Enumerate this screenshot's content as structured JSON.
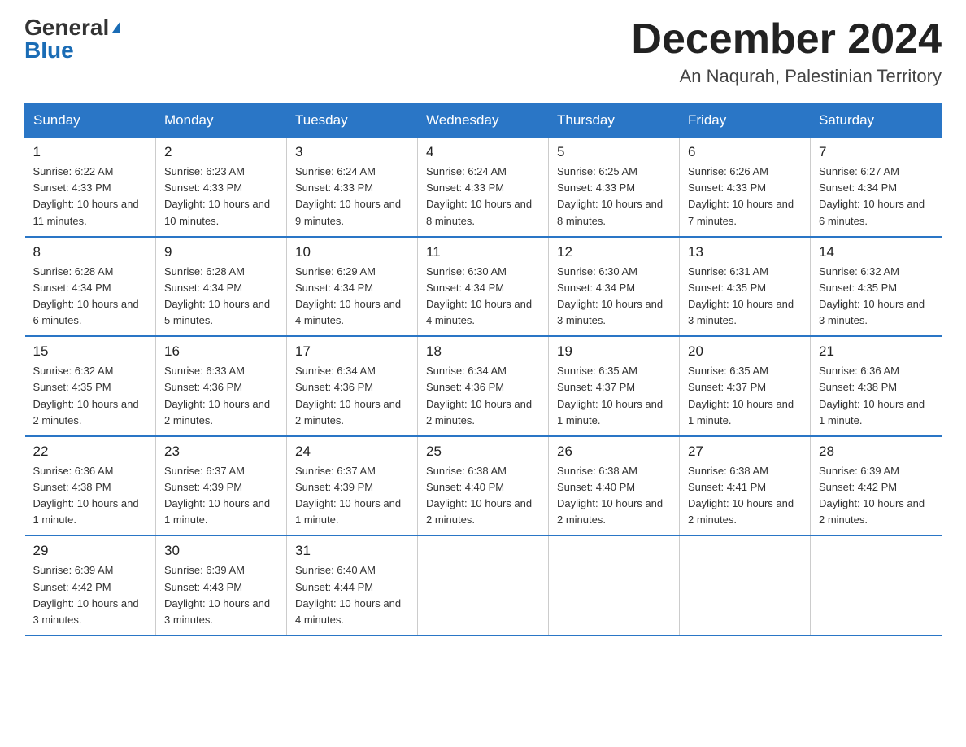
{
  "header": {
    "logo_general": "General",
    "logo_blue": "Blue",
    "month_title": "December 2024",
    "location": "An Naqurah, Palestinian Territory"
  },
  "columns": [
    "Sunday",
    "Monday",
    "Tuesday",
    "Wednesday",
    "Thursday",
    "Friday",
    "Saturday"
  ],
  "weeks": [
    [
      {
        "day": "1",
        "sunrise": "Sunrise: 6:22 AM",
        "sunset": "Sunset: 4:33 PM",
        "daylight": "Daylight: 10 hours and 11 minutes."
      },
      {
        "day": "2",
        "sunrise": "Sunrise: 6:23 AM",
        "sunset": "Sunset: 4:33 PM",
        "daylight": "Daylight: 10 hours and 10 minutes."
      },
      {
        "day": "3",
        "sunrise": "Sunrise: 6:24 AM",
        "sunset": "Sunset: 4:33 PM",
        "daylight": "Daylight: 10 hours and 9 minutes."
      },
      {
        "day": "4",
        "sunrise": "Sunrise: 6:24 AM",
        "sunset": "Sunset: 4:33 PM",
        "daylight": "Daylight: 10 hours and 8 minutes."
      },
      {
        "day": "5",
        "sunrise": "Sunrise: 6:25 AM",
        "sunset": "Sunset: 4:33 PM",
        "daylight": "Daylight: 10 hours and 8 minutes."
      },
      {
        "day": "6",
        "sunrise": "Sunrise: 6:26 AM",
        "sunset": "Sunset: 4:33 PM",
        "daylight": "Daylight: 10 hours and 7 minutes."
      },
      {
        "day": "7",
        "sunrise": "Sunrise: 6:27 AM",
        "sunset": "Sunset: 4:34 PM",
        "daylight": "Daylight: 10 hours and 6 minutes."
      }
    ],
    [
      {
        "day": "8",
        "sunrise": "Sunrise: 6:28 AM",
        "sunset": "Sunset: 4:34 PM",
        "daylight": "Daylight: 10 hours and 6 minutes."
      },
      {
        "day": "9",
        "sunrise": "Sunrise: 6:28 AM",
        "sunset": "Sunset: 4:34 PM",
        "daylight": "Daylight: 10 hours and 5 minutes."
      },
      {
        "day": "10",
        "sunrise": "Sunrise: 6:29 AM",
        "sunset": "Sunset: 4:34 PM",
        "daylight": "Daylight: 10 hours and 4 minutes."
      },
      {
        "day": "11",
        "sunrise": "Sunrise: 6:30 AM",
        "sunset": "Sunset: 4:34 PM",
        "daylight": "Daylight: 10 hours and 4 minutes."
      },
      {
        "day": "12",
        "sunrise": "Sunrise: 6:30 AM",
        "sunset": "Sunset: 4:34 PM",
        "daylight": "Daylight: 10 hours and 3 minutes."
      },
      {
        "day": "13",
        "sunrise": "Sunrise: 6:31 AM",
        "sunset": "Sunset: 4:35 PM",
        "daylight": "Daylight: 10 hours and 3 minutes."
      },
      {
        "day": "14",
        "sunrise": "Sunrise: 6:32 AM",
        "sunset": "Sunset: 4:35 PM",
        "daylight": "Daylight: 10 hours and 3 minutes."
      }
    ],
    [
      {
        "day": "15",
        "sunrise": "Sunrise: 6:32 AM",
        "sunset": "Sunset: 4:35 PM",
        "daylight": "Daylight: 10 hours and 2 minutes."
      },
      {
        "day": "16",
        "sunrise": "Sunrise: 6:33 AM",
        "sunset": "Sunset: 4:36 PM",
        "daylight": "Daylight: 10 hours and 2 minutes."
      },
      {
        "day": "17",
        "sunrise": "Sunrise: 6:34 AM",
        "sunset": "Sunset: 4:36 PM",
        "daylight": "Daylight: 10 hours and 2 minutes."
      },
      {
        "day": "18",
        "sunrise": "Sunrise: 6:34 AM",
        "sunset": "Sunset: 4:36 PM",
        "daylight": "Daylight: 10 hours and 2 minutes."
      },
      {
        "day": "19",
        "sunrise": "Sunrise: 6:35 AM",
        "sunset": "Sunset: 4:37 PM",
        "daylight": "Daylight: 10 hours and 1 minute."
      },
      {
        "day": "20",
        "sunrise": "Sunrise: 6:35 AM",
        "sunset": "Sunset: 4:37 PM",
        "daylight": "Daylight: 10 hours and 1 minute."
      },
      {
        "day": "21",
        "sunrise": "Sunrise: 6:36 AM",
        "sunset": "Sunset: 4:38 PM",
        "daylight": "Daylight: 10 hours and 1 minute."
      }
    ],
    [
      {
        "day": "22",
        "sunrise": "Sunrise: 6:36 AM",
        "sunset": "Sunset: 4:38 PM",
        "daylight": "Daylight: 10 hours and 1 minute."
      },
      {
        "day": "23",
        "sunrise": "Sunrise: 6:37 AM",
        "sunset": "Sunset: 4:39 PM",
        "daylight": "Daylight: 10 hours and 1 minute."
      },
      {
        "day": "24",
        "sunrise": "Sunrise: 6:37 AM",
        "sunset": "Sunset: 4:39 PM",
        "daylight": "Daylight: 10 hours and 1 minute."
      },
      {
        "day": "25",
        "sunrise": "Sunrise: 6:38 AM",
        "sunset": "Sunset: 4:40 PM",
        "daylight": "Daylight: 10 hours and 2 minutes."
      },
      {
        "day": "26",
        "sunrise": "Sunrise: 6:38 AM",
        "sunset": "Sunset: 4:40 PM",
        "daylight": "Daylight: 10 hours and 2 minutes."
      },
      {
        "day": "27",
        "sunrise": "Sunrise: 6:38 AM",
        "sunset": "Sunset: 4:41 PM",
        "daylight": "Daylight: 10 hours and 2 minutes."
      },
      {
        "day": "28",
        "sunrise": "Sunrise: 6:39 AM",
        "sunset": "Sunset: 4:42 PM",
        "daylight": "Daylight: 10 hours and 2 minutes."
      }
    ],
    [
      {
        "day": "29",
        "sunrise": "Sunrise: 6:39 AM",
        "sunset": "Sunset: 4:42 PM",
        "daylight": "Daylight: 10 hours and 3 minutes."
      },
      {
        "day": "30",
        "sunrise": "Sunrise: 6:39 AM",
        "sunset": "Sunset: 4:43 PM",
        "daylight": "Daylight: 10 hours and 3 minutes."
      },
      {
        "day": "31",
        "sunrise": "Sunrise: 6:40 AM",
        "sunset": "Sunset: 4:44 PM",
        "daylight": "Daylight: 10 hours and 4 minutes."
      },
      null,
      null,
      null,
      null
    ]
  ]
}
